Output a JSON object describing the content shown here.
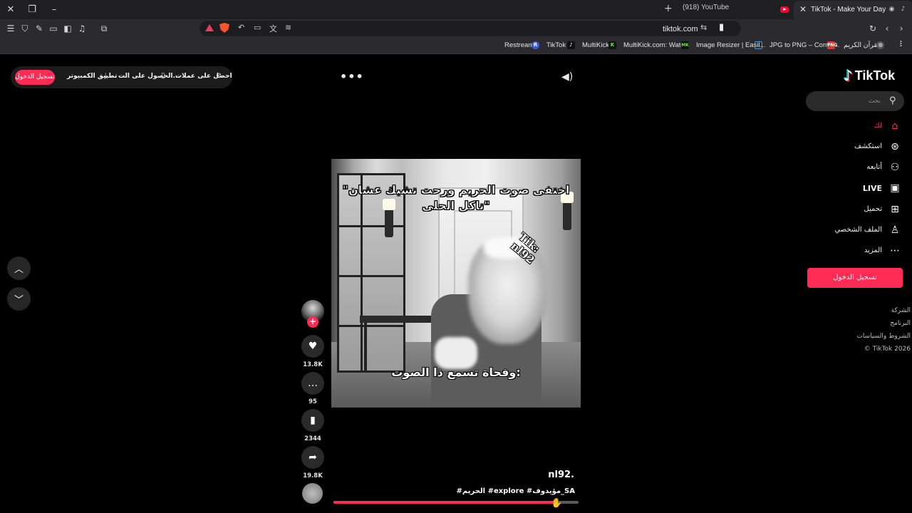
{
  "browser": {
    "tabs": [
      {
        "title": "(918) YouTube",
        "active": false
      },
      {
        "title": "TikTok - Make Your Day",
        "active": true
      }
    ],
    "address": "tiktok.com",
    "bookmarks": [
      "Restream",
      "TikTok",
      "MultiKick",
      "MultiKick.com: Watc...",
      "Image Resizer | Easil...",
      "JPG to PNG – Conve...",
      "القرآن الكريم"
    ]
  },
  "topbar": {
    "login": "تسجيل الدخول",
    "desktop_app": "تطبيق الكمبيوتر",
    "get_app": "الحصول على الت...",
    "get_coins": "احصل على عملات"
  },
  "sidebar": {
    "logo": "TikTok",
    "search_placeholder": "بحث",
    "nav": [
      {
        "label": "لك",
        "icon": "home-icon"
      },
      {
        "label": "استكشف",
        "icon": "compass-icon"
      },
      {
        "label": "أتابعه",
        "icon": "following-icon"
      },
      {
        "label": "LIVE",
        "icon": "live-icon"
      },
      {
        "label": "تحميل",
        "icon": "upload-icon"
      },
      {
        "label": "الملف الشخصي",
        "icon": "profile-icon"
      },
      {
        "label": "المزيد",
        "icon": "more-icon"
      }
    ],
    "login_button": "تسجيل الدخول",
    "footer": [
      "الشركة",
      "البرنامج",
      "الشروط والسياسات",
      "© TikTok 2026"
    ]
  },
  "video": {
    "caption_top": "\"اختفى صوت الحريم ورحت تشيك عشان تاكل الحلى\"",
    "caption_bottom": "وفجاة تسمع ذا الصوت:",
    "watermark_line1": "Tik:",
    "watermark_line2": "nl92",
    "author": "nl92.",
    "description": "#الحريم #explore #مؤيدوف_SA",
    "progress": 0.91
  },
  "actions": {
    "likes": "13.8K",
    "comments": "95",
    "saves": "2344",
    "shares": "19.8K"
  },
  "colors": {
    "accent": "#fe2c55",
    "page_bg": "#000000",
    "chrome_bg": "#2b2b2f"
  }
}
